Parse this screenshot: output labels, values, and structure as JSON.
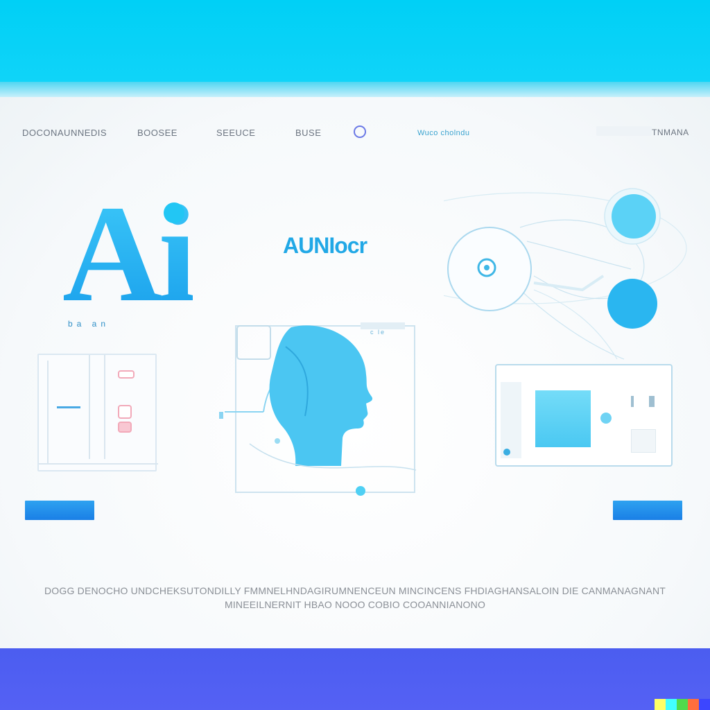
{
  "nav": {
    "items": [
      "DOCONAUNNEDIS",
      "BOOSEE",
      "SEEUCE",
      "BUSE"
    ],
    "link": "Wuco cholndu",
    "right": "TNMANA"
  },
  "hero": {
    "logo_text": "Ai",
    "logo_caption": "ba an",
    "brand": "AUNIocr",
    "card_label": "c le"
  },
  "body_copy": {
    "line1": "DOGG DENOCHO UNDCHEKSUTONDILLY FMMNELHNDAGIRUMNENCEUN MINCINCENS FHDIAGHANSALOIN DIE CANMANAGNANT",
    "line2": "MINEEILNERNIT HBAO NOOO COBIO COOANNIANONO"
  },
  "colors": {
    "top_band": "#00d0f6",
    "accent_blue": "#1cb4f0",
    "cta_blue": "#1a7fe6",
    "bottom_band": "#4b5df0",
    "strip": [
      "#ffff66",
      "#42ffff",
      "#51da4c",
      "#ff6e3c",
      "#3c46ff"
    ]
  }
}
